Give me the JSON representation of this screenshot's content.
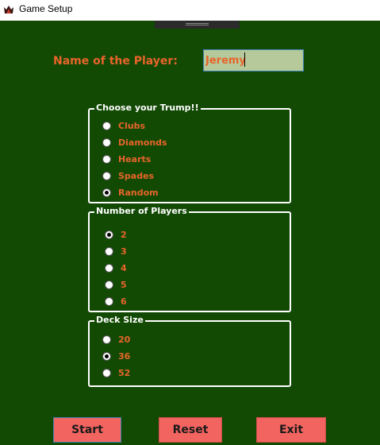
{
  "window": {
    "title": "Game Setup",
    "icon": "game-icon"
  },
  "player": {
    "label": "Name of the Player:",
    "value": "Jeremy"
  },
  "trump": {
    "title": "Choose your Trump!!",
    "options": [
      "Clubs",
      "Diamonds",
      "Hearts",
      "Spades",
      "Random"
    ],
    "selected": "Random"
  },
  "players": {
    "title": "Number of Players",
    "options": [
      "2",
      "3",
      "4",
      "5",
      "6"
    ],
    "selected": "2"
  },
  "deck": {
    "title": "Deck Size",
    "options": [
      "20",
      "36",
      "52"
    ],
    "selected": "36"
  },
  "buttons": {
    "start": "Start",
    "reset": "Reset",
    "exit": "Exit"
  },
  "colors": {
    "background": "#124a04",
    "accent": "#e8642a",
    "button": "#f26460",
    "input": "#b5c99a"
  }
}
